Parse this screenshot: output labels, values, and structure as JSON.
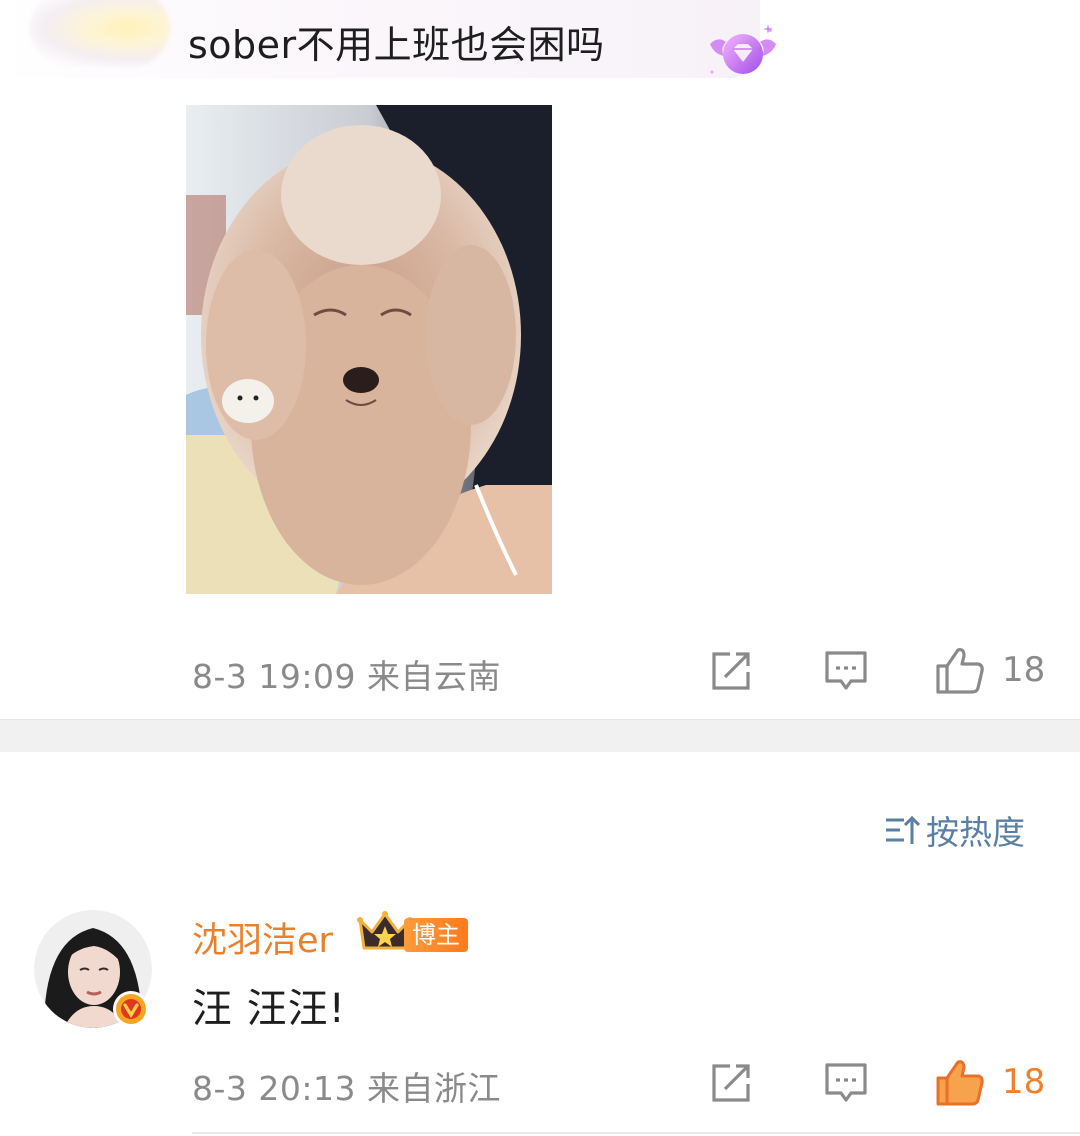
{
  "top_post": {
    "text": "sober不用上班也会困吗",
    "timestamp_location": "8-3 19:09  来自云南",
    "like_count": "18",
    "image_icon": "dog-photo",
    "badge_icon": "diamond-wings-badge-icon"
  },
  "sort": {
    "label": "按热度",
    "icon": "sort-icon"
  },
  "comment": {
    "author": "沈羽洁er",
    "author_tag": "博主",
    "text": "汪 汪汪!",
    "timestamp_location": "8-3 20:13  来自浙江",
    "like_count": "18",
    "liked": true
  },
  "colors": {
    "name_orange": "#e8802c",
    "like_active": "#f0802c",
    "meta_gray": "#8a8a8a",
    "sort_blue": "#5b7ea3",
    "separator": "#f1f1f1"
  }
}
